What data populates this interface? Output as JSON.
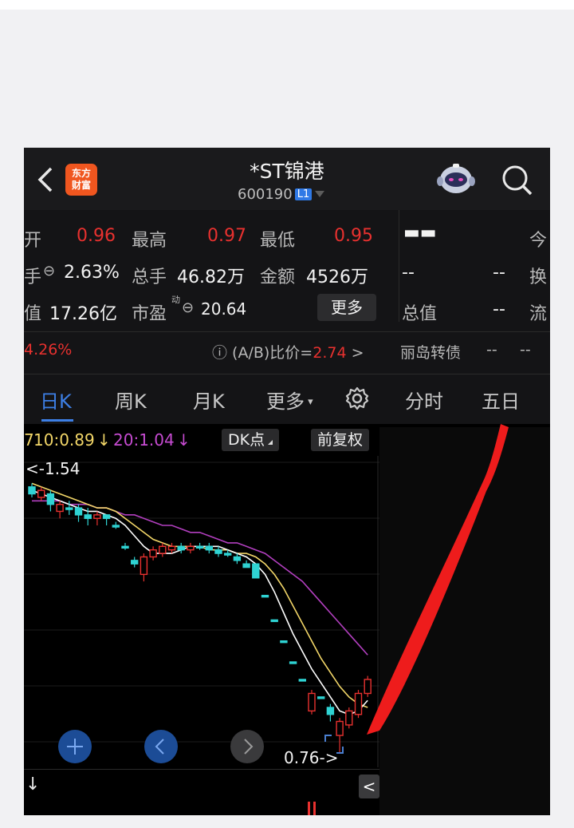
{
  "header": {
    "title": "*ST锦港",
    "code": "600190",
    "level_badge": "L1",
    "logo_line1": "东方",
    "logo_line2": "财富"
  },
  "quote": {
    "open_label": "开",
    "open_value": "0.96",
    "high_label": "最高",
    "high_value": "0.97",
    "low_label": "最低",
    "low_value": "0.95",
    "right_dash1": "▬▬",
    "today_label": "今",
    "turnover_label": "手",
    "turnover_value": "2.63%",
    "volume_label": "总手",
    "volume_value": "46.82万",
    "amount_label": "金额",
    "amount_value": "4526万",
    "dash2a": "--",
    "dash2b": "--",
    "swap_label": "换",
    "mcap_label": "值",
    "mcap_value": "17.26亿",
    "pe_label": "市盈",
    "pe_sup": "动",
    "pe_value": "20.64",
    "more_label": "更多",
    "total_mcap_label": "总值",
    "dash3": "--",
    "float_label": "流",
    "change_pct": "4.26%",
    "ab_label": "(A/B)比价=",
    "ab_value": "2.74",
    "ab_arrow": ">",
    "bond_label": "丽岛转债",
    "bond_dash1": "--",
    "bond_dash2": "--"
  },
  "tabs": [
    "日K",
    "周K",
    "月K",
    "更多",
    "分时",
    "五日"
  ],
  "ma": {
    "ma10": "10:0.89",
    "ma10_arrow": "↓",
    "ma20": "20:1.04",
    "ma20_arrow": "↓",
    "dk_label": "DK点",
    "fq_label": "前复权"
  },
  "chart_labels": {
    "max_label": "<-1.54",
    "min_label": "0.76->",
    "bottom_arrow": "↓",
    "collapse_icon": "<"
  },
  "colors": {
    "up": "#e8312f",
    "down": "#2fd3d3",
    "ma5": "#ffffff",
    "ma10": "#f2d668",
    "ma20": "#b23fbf",
    "accent": "#3d7fe5",
    "logo": "#f0561f"
  },
  "chart_data": {
    "type": "candlestick",
    "y_range": [
      0.76,
      1.54
    ],
    "candles": [
      {
        "o": 1.52,
        "c": 1.5,
        "h": 1.53,
        "l": 1.49
      },
      {
        "o": 1.49,
        "c": 1.51,
        "h": 1.52,
        "l": 1.48
      },
      {
        "o": 1.5,
        "c": 1.47,
        "h": 1.51,
        "l": 1.45
      },
      {
        "o": 1.45,
        "c": 1.47,
        "h": 1.48,
        "l": 1.43
      },
      {
        "o": 1.46,
        "c": 1.46,
        "h": 1.48,
        "l": 1.44
      },
      {
        "o": 1.46,
        "c": 1.44,
        "h": 1.47,
        "l": 1.42
      },
      {
        "o": 1.44,
        "c": 1.43,
        "h": 1.46,
        "l": 1.41
      },
      {
        "o": 1.43,
        "c": 1.44,
        "h": 1.45,
        "l": 1.41
      },
      {
        "o": 1.44,
        "c": 1.43,
        "h": 1.44,
        "l": 1.41
      },
      {
        "o": 1.41,
        "c": 1.41,
        "h": 1.42,
        "l": 1.4
      },
      {
        "o": 1.35,
        "c": 1.35,
        "h": 1.36,
        "l": 1.34
      },
      {
        "o": 1.31,
        "c": 1.3,
        "h": 1.32,
        "l": 1.29
      },
      {
        "o": 1.27,
        "c": 1.32,
        "h": 1.33,
        "l": 1.25
      },
      {
        "o": 1.32,
        "c": 1.34,
        "h": 1.35,
        "l": 1.31
      },
      {
        "o": 1.33,
        "c": 1.35,
        "h": 1.36,
        "l": 1.32
      },
      {
        "o": 1.34,
        "c": 1.35,
        "h": 1.36,
        "l": 1.33
      },
      {
        "o": 1.35,
        "c": 1.34,
        "h": 1.36,
        "l": 1.33
      },
      {
        "o": 1.34,
        "c": 1.35,
        "h": 1.36,
        "l": 1.33
      },
      {
        "o": 1.35,
        "c": 1.35,
        "h": 1.36,
        "l": 1.34
      },
      {
        "o": 1.35,
        "c": 1.34,
        "h": 1.36,
        "l": 1.33
      },
      {
        "o": 1.34,
        "c": 1.33,
        "h": 1.35,
        "l": 1.32
      },
      {
        "o": 1.33,
        "c": 1.33,
        "h": 1.34,
        "l": 1.32
      },
      {
        "o": 1.32,
        "c": 1.31,
        "h": 1.33,
        "l": 1.3
      },
      {
        "o": 1.3,
        "c": 1.29,
        "h": 1.31,
        "l": 1.29
      },
      {
        "o": 1.3,
        "c": 1.26,
        "h": 1.3,
        "l": 1.26
      },
      {
        "o": 1.21,
        "c": 1.21,
        "h": 1.21,
        "l": 1.21
      },
      {
        "o": 1.14,
        "c": 1.14,
        "h": 1.14,
        "l": 1.14
      },
      {
        "o": 1.08,
        "c": 1.08,
        "h": 1.08,
        "l": 1.08
      },
      {
        "o": 1.02,
        "c": 1.02,
        "h": 1.02,
        "l": 1.02
      },
      {
        "o": 0.97,
        "c": 0.97,
        "h": 0.97,
        "l": 0.97
      },
      {
        "o": 0.88,
        "c": 0.93,
        "h": 0.94,
        "l": 0.87
      },
      {
        "o": 0.92,
        "c": 0.92,
        "h": 0.92,
        "l": 0.92
      },
      {
        "o": 0.89,
        "c": 0.87,
        "h": 0.9,
        "l": 0.85
      },
      {
        "o": 0.81,
        "c": 0.85,
        "h": 0.86,
        "l": 0.76
      },
      {
        "o": 0.84,
        "c": 0.88,
        "h": 0.89,
        "l": 0.83
      },
      {
        "o": 0.87,
        "c": 0.93,
        "h": 0.94,
        "l": 0.86
      },
      {
        "o": 0.93,
        "c": 0.97,
        "h": 0.98,
        "l": 0.92
      }
    ],
    "ma5": [
      1.51,
      1.5,
      1.49,
      1.48,
      1.47,
      1.46,
      1.45,
      1.45,
      1.44,
      1.43,
      1.41,
      1.38,
      1.35,
      1.33,
      1.33,
      1.33,
      1.34,
      1.35,
      1.35,
      1.35,
      1.35,
      1.34,
      1.33,
      1.32,
      1.3,
      1.27,
      1.22,
      1.16,
      1.1,
      1.05,
      1.0,
      0.96,
      0.92,
      0.88,
      0.87,
      0.88,
      0.91
    ],
    "ma10": [
      1.53,
      1.52,
      1.51,
      1.5,
      1.49,
      1.48,
      1.47,
      1.46,
      1.46,
      1.45,
      1.43,
      1.41,
      1.39,
      1.37,
      1.36,
      1.35,
      1.35,
      1.35,
      1.35,
      1.34,
      1.34,
      1.34,
      1.33,
      1.33,
      1.32,
      1.3,
      1.27,
      1.23,
      1.18,
      1.13,
      1.08,
      1.03,
      0.99,
      0.95,
      0.92,
      0.9,
      0.89
    ],
    "ma20": [
      1.48,
      1.48,
      1.48,
      1.48,
      1.47,
      1.47,
      1.47,
      1.46,
      1.46,
      1.45,
      1.44,
      1.44,
      1.43,
      1.42,
      1.41,
      1.41,
      1.4,
      1.39,
      1.39,
      1.38,
      1.37,
      1.36,
      1.36,
      1.35,
      1.34,
      1.33,
      1.31,
      1.29,
      1.27,
      1.25,
      1.22,
      1.19,
      1.16,
      1.13,
      1.1,
      1.07,
      1.04
    ]
  }
}
